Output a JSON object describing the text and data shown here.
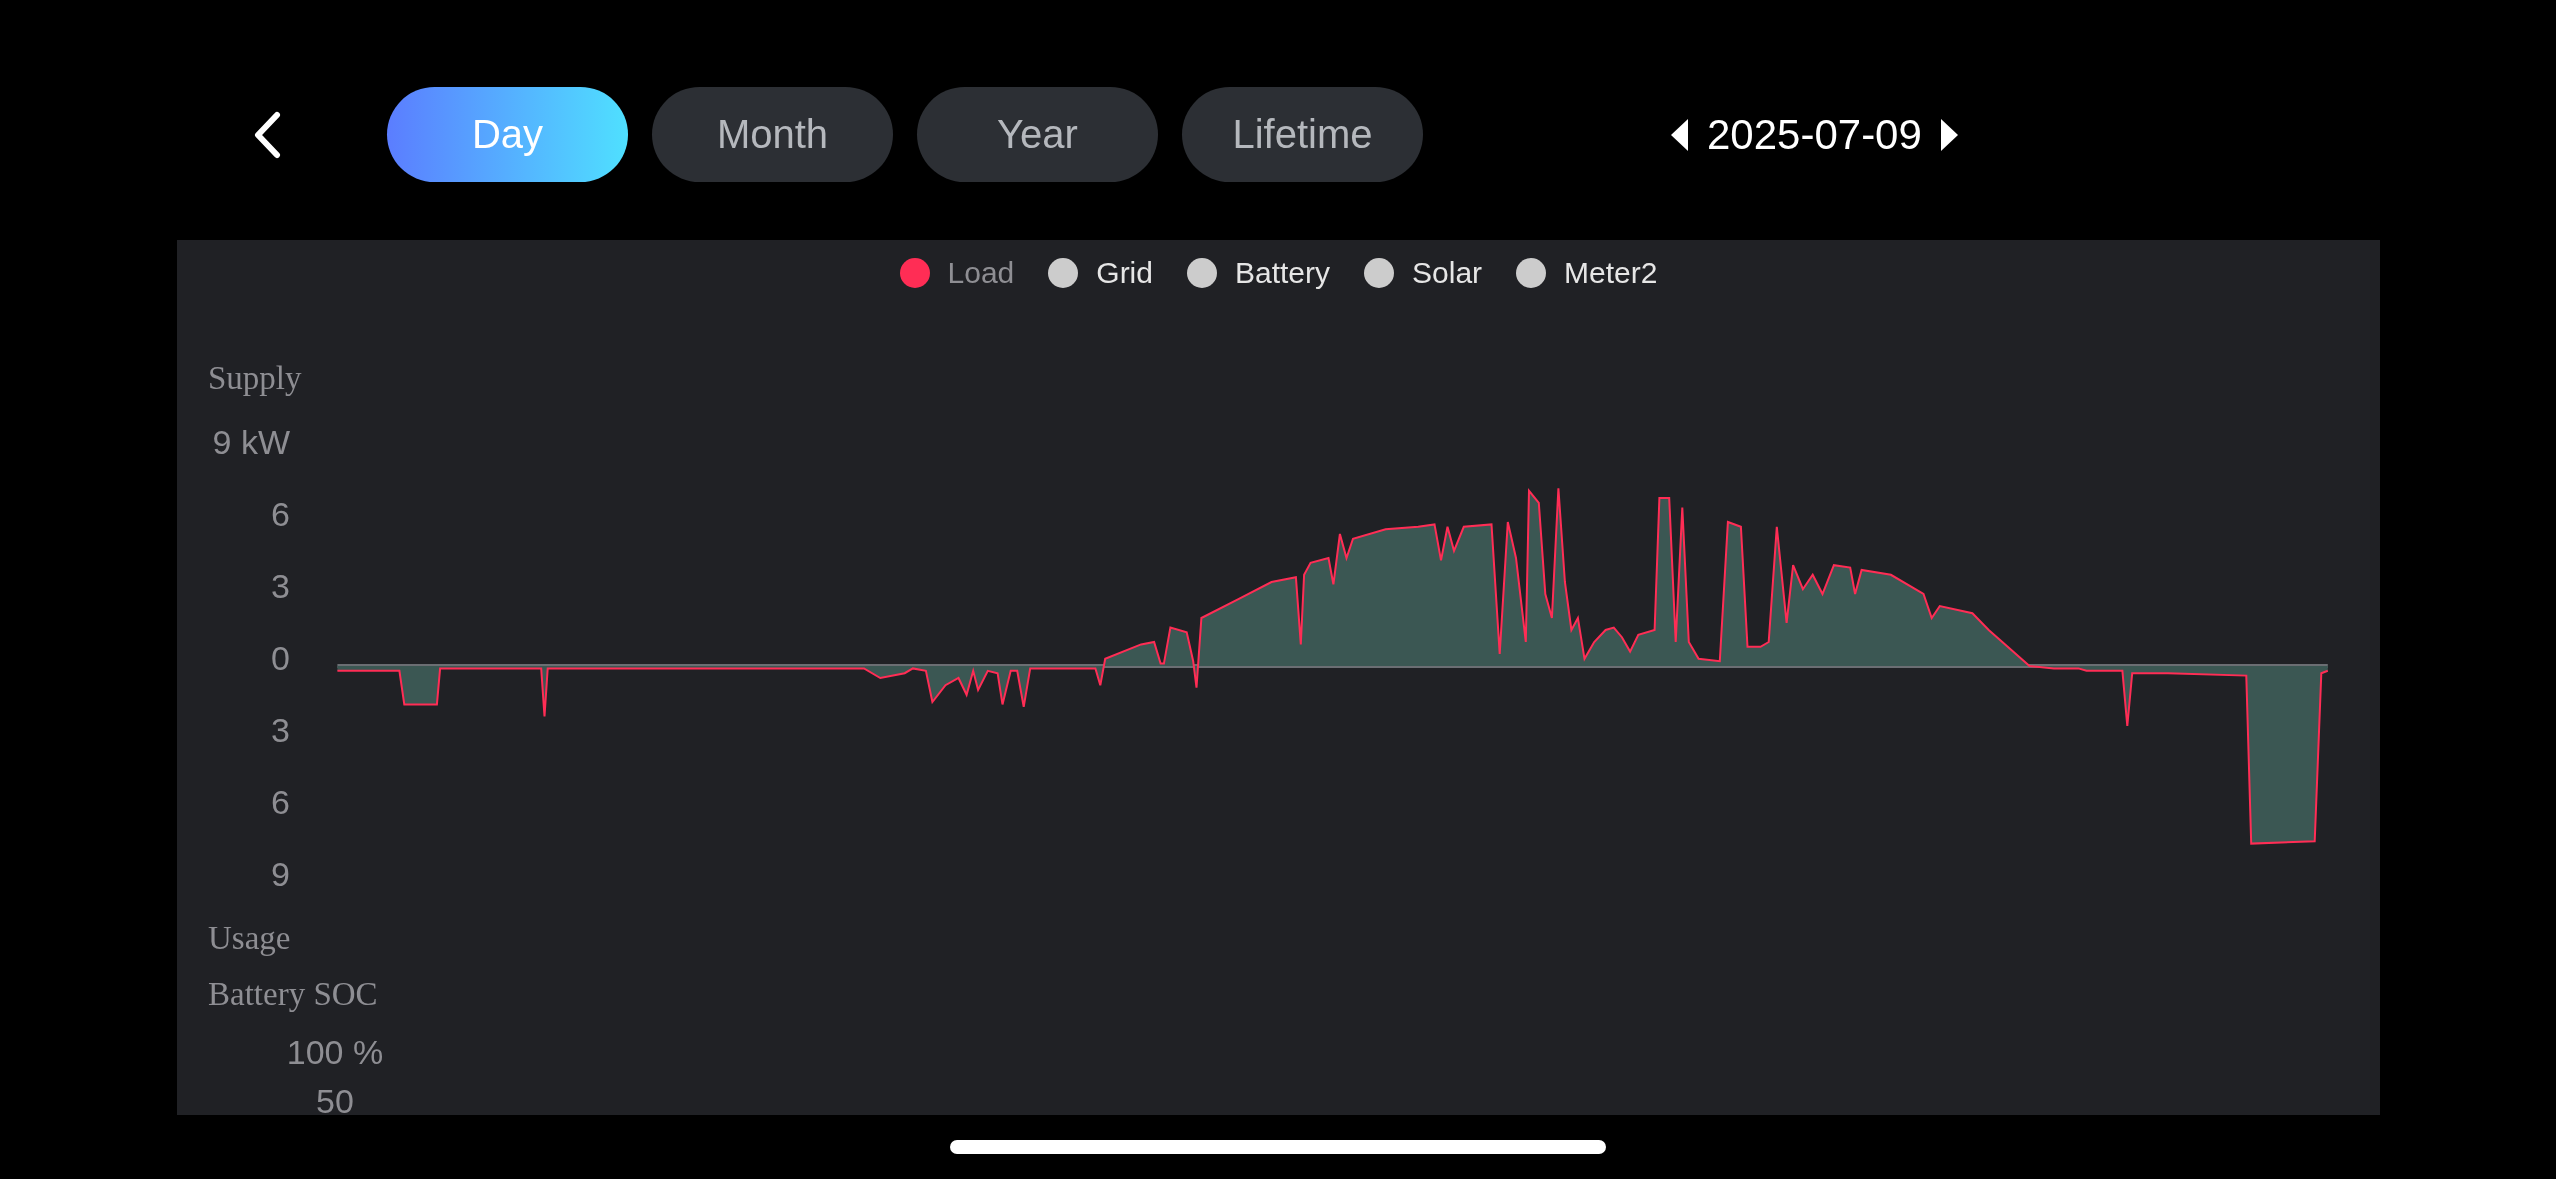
{
  "header": {
    "tabs": [
      {
        "label": "Day",
        "selected": true
      },
      {
        "label": "Month",
        "selected": false
      },
      {
        "label": "Year",
        "selected": false
      },
      {
        "label": "Lifetime",
        "selected": false
      }
    ],
    "date": "2025-07-09"
  },
  "chart": {
    "legend": [
      {
        "label": "Load",
        "color": "#ff2d55",
        "selected": true
      },
      {
        "label": "Grid",
        "color": "#cccccc",
        "selected": false
      },
      {
        "label": "Battery",
        "color": "#cccccc",
        "selected": false
      },
      {
        "label": "Solar",
        "color": "#cccccc",
        "selected": false
      },
      {
        "label": "Meter2",
        "color": "#cccccc",
        "selected": false
      }
    ],
    "power_axis": {
      "title": "Supply",
      "ticks": [
        "9 kW",
        "6",
        "3",
        "0",
        "3",
        "6",
        "9"
      ],
      "bottom_title": "Usage"
    },
    "soc_axis": {
      "title": "Battery SOC",
      "ticks": [
        "100 %",
        "50"
      ]
    }
  }
}
